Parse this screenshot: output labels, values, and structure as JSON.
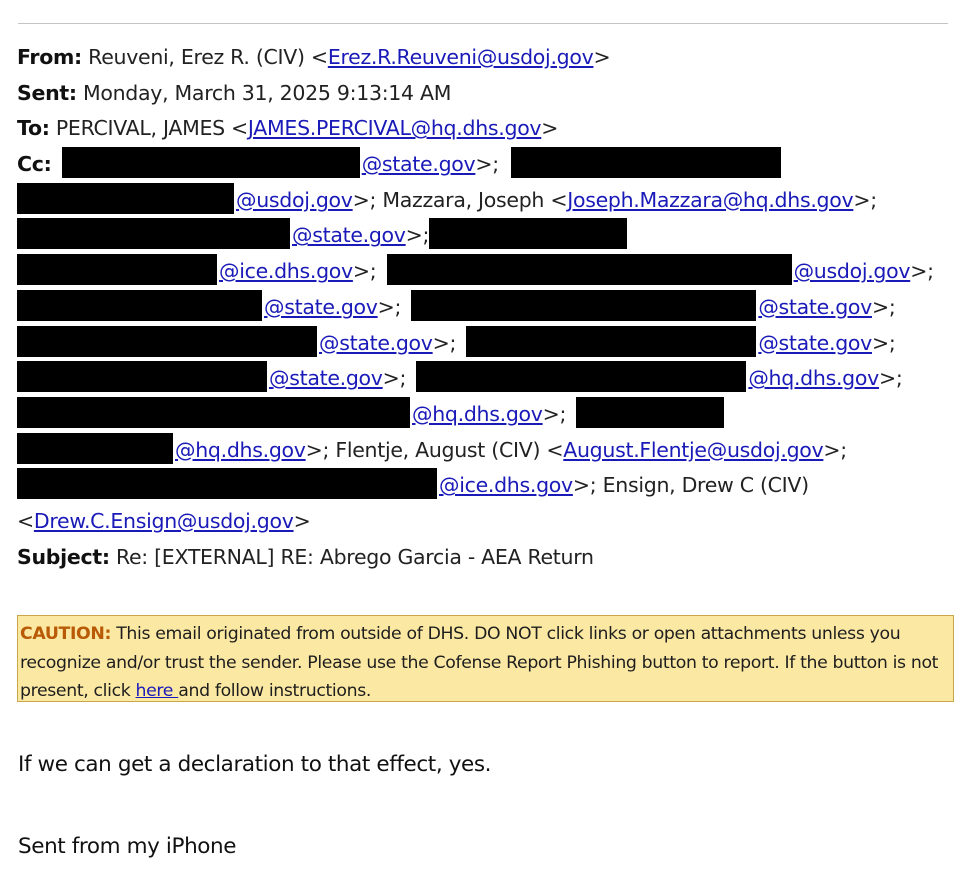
{
  "header": {
    "from_label": "From:",
    "from_name": "Reuveni, Erez R. (CIV) <",
    "from_email": "Erez.R.Reuveni@usdoj.gov",
    "sent_label": "Sent:",
    "sent_value": "Monday, March 31, 2025 9:13:14 AM",
    "to_label": "To:",
    "to_name": "PERCIVAL, JAMES <",
    "to_email": "JAMES.PERCIVAL@hq.dhs.gov",
    "cc_label": "Cc:",
    "subject_label": "Subject:",
    "subject_value": "Re: [EXTERNAL] RE: Abrego Garcia - AEA Return"
  },
  "cc": {
    "d_state": "@state.gov",
    "d_usdoj": "@usdoj.gov",
    "d_ice": "@ice.dhs.gov",
    "d_hq": "@hq.dhs.gov",
    "close_semi": ">;",
    "close": ">",
    "mazzara_name": "; Mazzara, Joseph <",
    "mazzara_email": "Joseph.Mazzara@hq.dhs.gov",
    "flentje_name": "; Flentje, August (CIV) <",
    "flentje_email": "August.Flentje@usdoj.gov",
    "ensign_name": "; Ensign, Drew C (CIV)",
    "ensign_open": "<",
    "ensign_email": "Drew.C.Ensign@usdoj.gov"
  },
  "caution": {
    "label": "CAUTION:",
    "text_before": " This email originated from outside of DHS. DO NOT click links or open attachments unless you recognize and/or trust the sender. Please use the Cofense Report Phishing button to report. If the button is not present, click ",
    "link": "here ",
    "text_after": "and follow instructions."
  },
  "body": {
    "line1": "If we can get a declaration to that effect, yes.",
    "line2": "Sent from my iPhone"
  }
}
